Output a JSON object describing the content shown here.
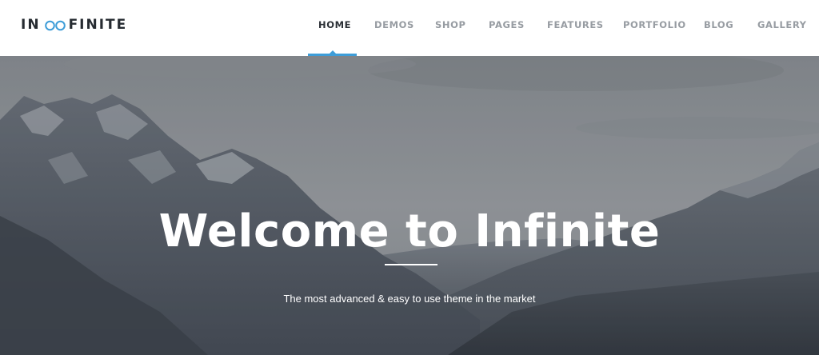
{
  "brand": {
    "name_left": "IN",
    "name_right": "FINITE",
    "logo_icon": "infinity-icon",
    "accent_color": "#3e9dd8"
  },
  "nav": {
    "items": [
      {
        "label": "HOME",
        "active": true
      },
      {
        "label": "DEMOS",
        "active": false
      },
      {
        "label": "SHOP",
        "active": false
      },
      {
        "label": "PAGES",
        "active": false
      },
      {
        "label": "FEATURES",
        "active": false
      },
      {
        "label": "PORTFOLIO",
        "active": false
      },
      {
        "label": "BLOG",
        "active": false
      },
      {
        "label": "GALLERY",
        "active": false
      }
    ]
  },
  "hero": {
    "title": "Welcome to Infinite",
    "subtitle": "The most advanced & easy to use theme in the market",
    "background": "mountain-landscape-image"
  }
}
